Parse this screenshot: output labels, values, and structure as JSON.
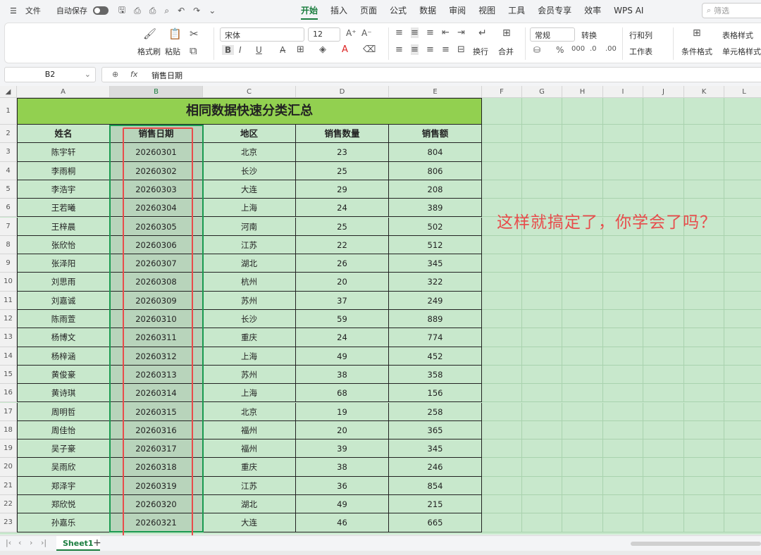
{
  "menu": {
    "file": "文件",
    "autosave": "自动保存",
    "tabs": [
      "开始",
      "插入",
      "页面",
      "公式",
      "数据",
      "审阅",
      "视图",
      "工具",
      "会员专享",
      "效率",
      "WPS AI"
    ],
    "search_placeholder": "筛选"
  },
  "ribbon": {
    "format_painter": "格式刷",
    "paste": "粘贴",
    "font_name": "宋体",
    "font_size": "12",
    "wrap": "换行",
    "merge": "合并",
    "number_format": "常规",
    "convert": "转换",
    "row_col": "行和列",
    "worksheet": "工作表",
    "cond_format": "条件格式",
    "table_style": "表格样式",
    "cell_style": "单元格样式"
  },
  "formula_bar": {
    "name_box": "B2",
    "fx": "fx",
    "content": "销售日期"
  },
  "columns": [
    "A",
    "B",
    "C",
    "D",
    "E",
    "F",
    "G",
    "H",
    "I",
    "J",
    "K",
    "L"
  ],
  "selected_column": "B",
  "title": "相同数据快速分类汇总",
  "headers": [
    "姓名",
    "销售日期",
    "地区",
    "销售数量",
    "销售额"
  ],
  "rows": [
    [
      "陈宇轩",
      "20260301",
      "北京",
      "23",
      "804"
    ],
    [
      "李雨桐",
      "20260302",
      "长沙",
      "25",
      "806"
    ],
    [
      "李浩宇",
      "20260303",
      "大连",
      "29",
      "208"
    ],
    [
      "王若曦",
      "20260304",
      "上海",
      "24",
      "389"
    ],
    [
      "王梓晨",
      "20260305",
      "河南",
      "25",
      "502"
    ],
    [
      "张欣怡",
      "20260306",
      "江苏",
      "22",
      "512"
    ],
    [
      "张泽阳",
      "20260307",
      "湖北",
      "26",
      "345"
    ],
    [
      "刘思雨",
      "20260308",
      "杭州",
      "20",
      "322"
    ],
    [
      "刘嘉诚",
      "20260309",
      "苏州",
      "37",
      "249"
    ],
    [
      "陈雨萱",
      "20260310",
      "长沙",
      "59",
      "889"
    ],
    [
      "杨博文",
      "20260311",
      "重庆",
      "24",
      "774"
    ],
    [
      "杨梓涵",
      "20260312",
      "上海",
      "49",
      "452"
    ],
    [
      "黄俊豪",
      "20260313",
      "苏州",
      "38",
      "358"
    ],
    [
      "黄诗琪",
      "20260314",
      "上海",
      "68",
      "156"
    ],
    [
      "周明哲",
      "20260315",
      "北京",
      "19",
      "258"
    ],
    [
      "周佳怡",
      "20260316",
      "福州",
      "20",
      "365"
    ],
    [
      "吴子豪",
      "20260317",
      "福州",
      "39",
      "345"
    ],
    [
      "吴雨欣",
      "20260318",
      "重庆",
      "38",
      "246"
    ],
    [
      "郑泽宇",
      "20260319",
      "江苏",
      "36",
      "854"
    ],
    [
      "郑欣悦",
      "20260320",
      "湖北",
      "49",
      "215"
    ],
    [
      "孙嘉乐",
      "20260321",
      "大连",
      "46",
      "665"
    ]
  ],
  "annotation": "这样就搞定了，你学会了吗？",
  "sheet_tab": "Sheet1",
  "colors": {
    "accent": "#1a7d3e",
    "title_fill": "#92d050",
    "sheet_fill": "#c8e8cc",
    "annotation": "#e84b4b"
  }
}
